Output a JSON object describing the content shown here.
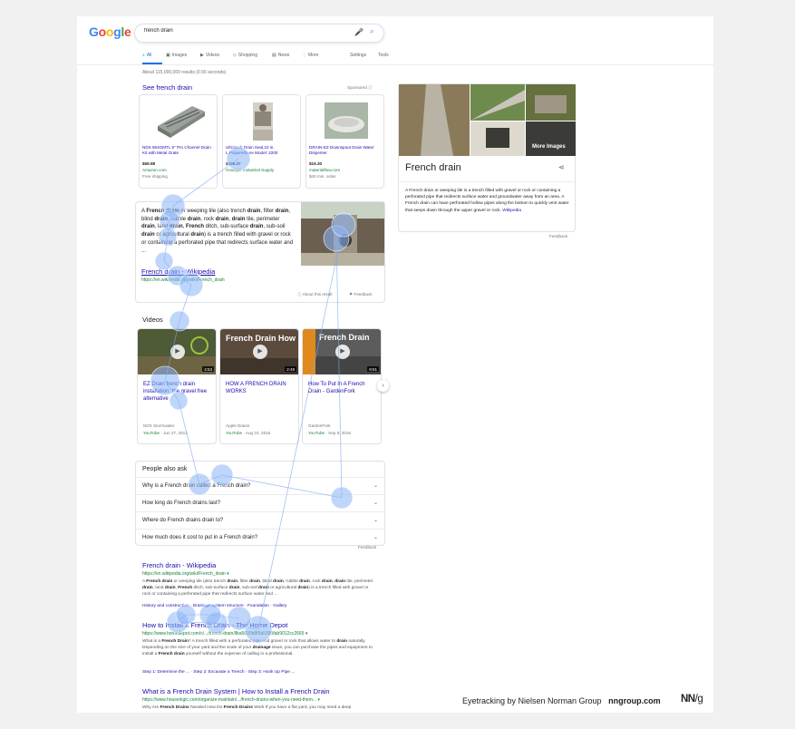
{
  "header": {
    "logo_letters": [
      {
        "ch": "G",
        "color": "#4285f4"
      },
      {
        "ch": "o",
        "color": "#ea4335"
      },
      {
        "ch": "o",
        "color": "#fbbc05"
      },
      {
        "ch": "g",
        "color": "#4285f4"
      },
      {
        "ch": "l",
        "color": "#34a853"
      },
      {
        "ch": "e",
        "color": "#ea4335"
      }
    ],
    "search_value": "french drain"
  },
  "tabs": [
    {
      "id": "all",
      "label": "All",
      "icon": "search-icon"
    },
    {
      "id": "images",
      "label": "Images",
      "icon": "image-icon"
    },
    {
      "id": "videos",
      "label": "Videos",
      "icon": "video-icon"
    },
    {
      "id": "shopping",
      "label": "Shopping",
      "icon": "tag-icon"
    },
    {
      "id": "news",
      "label": "News",
      "icon": "news-icon"
    },
    {
      "id": "more",
      "label": "More",
      "icon": "more-vert-icon"
    },
    {
      "id": "settings",
      "label": "Settings",
      "icon": ""
    },
    {
      "id": "tools",
      "label": "Tools",
      "icon": ""
    }
  ],
  "result_stats": "About 115,000,000 results (0.56 seconds)",
  "shopping": {
    "heading": "See french drain",
    "sponsored": "Sponsored ⓘ",
    "products": [
      {
        "title": "NDS 864OMTL 5\" Pro Channel Drain Kit with Metal Grate",
        "price": "$59.98",
        "seller": "Amazon.com",
        "shipping": "Free shipping"
      },
      {
        "title": "Ultratech Drain Seal,10 in. L,Polyurethane Model: 2200",
        "price": "$106.37",
        "seller": "Grainger Industrial Supply",
        "shipping": ""
      },
      {
        "title": "DRAIN-EZ Downspout Drain Water Disperser",
        "price": "$15.30",
        "seller": "materialflow.com",
        "shipping": "$40 min. order"
      }
    ]
  },
  "featured": {
    "snippet_html": "A <b>French drain</b> or weeping tile (also trench <b>drain</b>, filter <b>drain</b>, blind <b>drain</b>, rubble <b>drain</b>, rock <b>drain</b>, <b>drain</b> tile, perimeter <b>drain</b>, land <b>drain</b>, <b>French</b> ditch, sub-surface <b>drain</b>, sub-soil <b>drain</b> or agricultural <b>drain</b>) is a trench filled with gravel or rock or containing a perforated pipe that redirects surface water and ...",
    "title": "French drain - Wikipedia",
    "url": "https://en.wikipedia.org/wiki/French_drain",
    "about": "ⓘ About this result",
    "feedback": "⚑ Feedback"
  },
  "videos": {
    "heading": "Videos",
    "items": [
      {
        "title": "EZ Drain french drain installation: the gravel free alternative",
        "duration": "4:53",
        "source": "NDS Stormwater",
        "platform": "YouTube",
        "date": "Jun 27, 2013",
        "overlay": ""
      },
      {
        "title": "HOW A FRENCH DRAIN WORKS",
        "duration": "2:49",
        "source": "Apple Drains",
        "platform": "YouTube",
        "date": "Aug 10, 2015",
        "overlay": "French Drain How it Works"
      },
      {
        "title": "How To Put In A French Drain - GardenFork",
        "duration": "9:51",
        "source": "GardenFork",
        "platform": "YouTube",
        "date": "Sep 9, 2016",
        "overlay": "French Drain"
      }
    ],
    "next_label": "›"
  },
  "paa": {
    "heading": "People also ask",
    "questions": [
      "Why is a French drain called a French drain?",
      "How long do French drains last?",
      "Where do French drains drain to?",
      "How much does it cost to put in a French drain?"
    ],
    "feedback": "Feedback"
  },
  "organic": [
    {
      "title": "French drain - Wikipedia",
      "url": "https://en.wikipedia.org/wiki/French_drain ▾",
      "snippet_html": "A <b>French drain</b> or weeping tile (also trench <b>drain</b>, filter <b>drain</b>, blind <b>drain</b>, rubble <b>drain</b>, rock <b>drain</b>, <b>drain</b> tile, perimeter <b>drain</b>, land <b>drain</b>, <b>French</b> ditch, sub-surface <b>drain</b>, sub-soil <b>drain</b> or agricultural <b>drain</b>) is a trench filled with gravel or rock or containing a perforated pipe that redirects surface water and ...",
      "links": "History and construction · Drainage system structure · Foundation · Gallery"
    },
    {
      "title": "How to Install a French Drain - The Home Depot",
      "url": "https://www.homedepot.com/c/.../french-drain/llba5830b8f9a5395fab9012cc2665 ▾",
      "snippet_html": "What is a <b>French Drain</b>? A trench filled with a perforated pipe and gravel or rock that allows water to <b>drain</b> naturally. Depending on the size of your yard and the scale of your <b>drainage</b> issue, you can purchase the pipes and equipment to install a <b>French drain</b> yourself without the expense of calling in a professional.",
      "links": "Step 1: Determine the ... · Step 2: Excavate a Trench · Step 3: Hook Up Pipe ..."
    },
    {
      "title": "What is a French Drain System | How to Install a French Drain",
      "url": "https://www.houselogic.com/organize-maintain/.../french-drains-when-you-need-them... ▾",
      "snippet_html": "Why Are <b>French Drains</b> Needed How Do <b>French Drains</b> Work If you have a flat yard, you may need a deep",
      "links": ""
    }
  ],
  "knowledge_panel": {
    "more_images": "More Images",
    "title": "French drain",
    "description": "A French drain or weeping tile is a trench filled with gravel or rock or containing a perforated pipe that redirects surface water and groundwater away from an area. A French drain can have perforated hollow pipes along the bottom to quickly vent water that seeps down through the upper gravel or rock.",
    "source": "Wikipedia",
    "feedback": "Feedback"
  },
  "eyetracking": {
    "fixation_color": "#8ab4f8",
    "path_color": "#7aa7f0"
  },
  "credit": {
    "text": "Eyetracking by Nielsen Norman Group",
    "domain": "nngroup.com",
    "logo_main": "NN",
    "logo_suffix": "/g"
  }
}
